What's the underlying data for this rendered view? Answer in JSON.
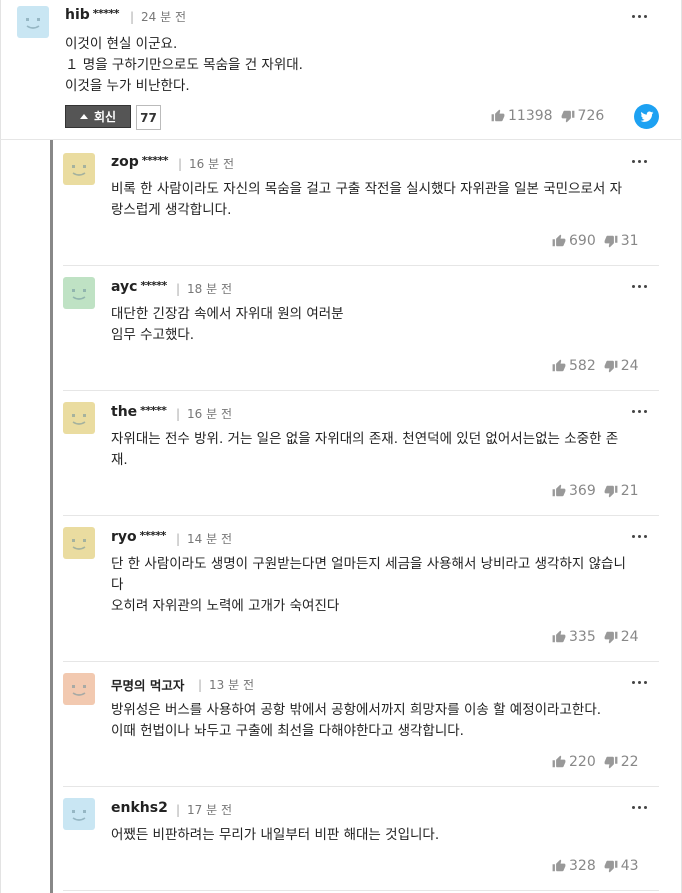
{
  "top_comment": {
    "username": "hib",
    "masked": "*****",
    "time": "24 분 전",
    "lines": [
      "이것이 현실 이군요.",
      "１ 명을 구하기만으로도 목숨을 건 자위대.",
      "이것을 누가 비난한다."
    ],
    "reply_label": "회신",
    "reply_count": "77",
    "likes": "11398",
    "dislikes": "726",
    "avatar_color": "#c9e6f3"
  },
  "replies": [
    {
      "username": "zop",
      "masked": "*****",
      "time": "16 분 전",
      "lines": [
        "비록 한 사람이라도 자신의 목숨을 걸고 구출 작전을 실시했다 자위관을 일본 국민으로서 자",
        "랑스럽게 생각합니다."
      ],
      "likes": "690",
      "dislikes": "31",
      "avatar_color": "#eadca0"
    },
    {
      "username": "ayc",
      "masked": "*****",
      "time": "18 분 전",
      "lines": [
        "대단한 긴장감 속에서 자위대 원의 여러분",
        "임무 수고했다."
      ],
      "likes": "582",
      "dislikes": "24",
      "avatar_color": "#bfe2c4"
    },
    {
      "username": "the",
      "masked": "*****",
      "time": "16 분 전",
      "lines": [
        "자위대는 전수 방위. 거는 일은 없을 자위대의 존재. 천연덕에 있던 없어서는없는 소중한 존",
        "재."
      ],
      "likes": "369",
      "dislikes": "21",
      "avatar_color": "#eadca0"
    },
    {
      "username": "ryo",
      "masked": "*****",
      "time": "14 분 전",
      "lines": [
        "단 한 사람이라도 생명이 구원받는다면 얼마든지 세금을 사용해서 낭비라고 생각하지 않습니",
        "다",
        "오히려 자위관의 노력에 고개가 숙여진다"
      ],
      "likes": "335",
      "dislikes": "24",
      "avatar_color": "#eadca0"
    },
    {
      "username": "무명의 먹고자",
      "masked": "",
      "time": "13 분 전",
      "lines": [
        "방위성은 버스를 사용하여 공항 밖에서 공항에서까지 희망자를 이송 할 예정이라고한다.",
        "이때 헌법이나 놔두고 구출에 최선을 다해야한다고 생각합니다."
      ],
      "likes": "220",
      "dislikes": "22",
      "avatar_color": "#f2c9b0"
    },
    {
      "username": "enkhs2",
      "masked": "",
      "time": "17 분 전",
      "lines": [
        "어쨌든 비판하려는 무리가 내일부터 비판 해대는 것입니다."
      ],
      "likes": "328",
      "dislikes": "43",
      "avatar_color": "#c9e6f3"
    }
  ],
  "icons": {
    "like": "thumbs-up-icon",
    "dislike": "thumbs-down-icon",
    "more": "more-icon",
    "share": "twitter-icon"
  }
}
